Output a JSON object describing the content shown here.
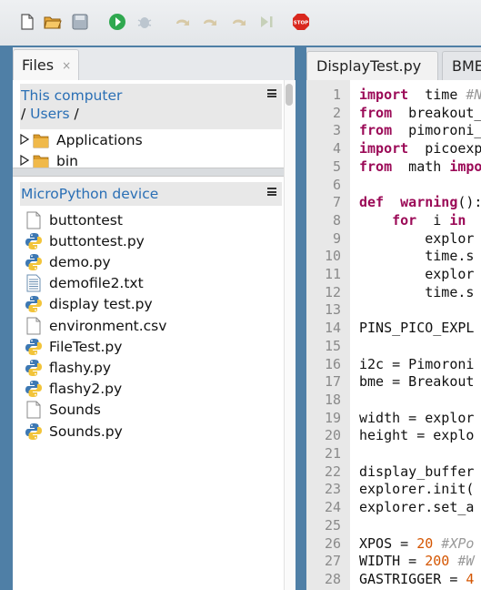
{
  "toolbar": {
    "buttons": [
      "new-file-icon",
      "open-folder-icon",
      "save-icon",
      "run-icon",
      "debug-icon",
      "step-over-icon",
      "step-into-icon",
      "step-out-icon",
      "resume-icon",
      "stop-icon"
    ],
    "stop_label": "STOP"
  },
  "files_panel": {
    "tab_label": "Files",
    "tab_close": "×",
    "computer": {
      "title": "This computer",
      "path": [
        "/",
        "Users",
        "/"
      ],
      "items": [
        {
          "label": "Applications",
          "type": "folder"
        },
        {
          "label": "bin",
          "type": "folder"
        }
      ]
    },
    "device": {
      "title": "MicroPython device",
      "items": [
        {
          "label": "buttontest",
          "type": "file"
        },
        {
          "label": "buttontest.py",
          "type": "python"
        },
        {
          "label": "demo.py",
          "type": "python"
        },
        {
          "label": "demofile2.txt",
          "type": "text"
        },
        {
          "label": "display test.py",
          "type": "python"
        },
        {
          "label": "environment.csv",
          "type": "file"
        },
        {
          "label": "FileTest.py",
          "type": "python"
        },
        {
          "label": "flashy.py",
          "type": "python"
        },
        {
          "label": "flashy2.py",
          "type": "python"
        },
        {
          "label": "Sounds",
          "type": "file"
        },
        {
          "label": "Sounds.py",
          "type": "python"
        }
      ]
    }
  },
  "editor": {
    "tabs": [
      "DisplayTest.py",
      "BME"
    ],
    "lines": [
      {
        "n": "1",
        "segs": [
          [
            "kw",
            "import"
          ],
          [
            "",
            "  time "
          ],
          [
            "cm",
            "#N"
          ]
        ]
      },
      {
        "n": "2",
        "segs": [
          [
            "kw",
            "from"
          ],
          [
            "",
            "  breakout_"
          ]
        ]
      },
      {
        "n": "3",
        "segs": [
          [
            "kw",
            "from"
          ],
          [
            "",
            "  pimoroni_"
          ]
        ]
      },
      {
        "n": "4",
        "segs": [
          [
            "kw",
            "import"
          ],
          [
            "",
            "  picoexp"
          ]
        ]
      },
      {
        "n": "5",
        "segs": [
          [
            "kw",
            "from"
          ],
          [
            "",
            "  math "
          ],
          [
            "kw",
            "impo"
          ]
        ]
      },
      {
        "n": "6",
        "segs": []
      },
      {
        "n": "7",
        "segs": [
          [
            "kw",
            "def"
          ],
          [
            "",
            "  "
          ],
          [
            "kw",
            "warning"
          ],
          [
            "",
            "():"
          ]
        ]
      },
      {
        "n": "8",
        "segs": [
          [
            "",
            "    "
          ],
          [
            "kw",
            "for"
          ],
          [
            "",
            "  i "
          ],
          [
            "kw",
            "in"
          ],
          [
            "",
            "  r"
          ]
        ]
      },
      {
        "n": "9",
        "segs": [
          [
            "",
            "        explor"
          ]
        ]
      },
      {
        "n": "10",
        "segs": [
          [
            "",
            "        time.s"
          ]
        ]
      },
      {
        "n": "11",
        "segs": [
          [
            "",
            "        explor"
          ]
        ]
      },
      {
        "n": "12",
        "segs": [
          [
            "",
            "        time.s"
          ]
        ]
      },
      {
        "n": "13",
        "segs": []
      },
      {
        "n": "14",
        "segs": [
          [
            "",
            "PINS_PICO_EXPL"
          ]
        ]
      },
      {
        "n": "15",
        "segs": []
      },
      {
        "n": "16",
        "segs": [
          [
            "",
            "i2c = Pimoroni"
          ]
        ]
      },
      {
        "n": "17",
        "segs": [
          [
            "",
            "bme = Breakout"
          ]
        ]
      },
      {
        "n": "18",
        "segs": []
      },
      {
        "n": "19",
        "segs": [
          [
            "",
            "width = explor"
          ]
        ]
      },
      {
        "n": "20",
        "segs": [
          [
            "",
            "height = explo"
          ]
        ]
      },
      {
        "n": "21",
        "segs": []
      },
      {
        "n": "22",
        "segs": [
          [
            "",
            "display_buffer"
          ]
        ]
      },
      {
        "n": "23",
        "segs": [
          [
            "",
            "explorer.init("
          ]
        ]
      },
      {
        "n": "24",
        "segs": [
          [
            "",
            "explorer.set_a"
          ]
        ]
      },
      {
        "n": "25",
        "segs": []
      },
      {
        "n": "26",
        "segs": [
          [
            "",
            "XPOS = "
          ],
          [
            "num",
            "20"
          ],
          [
            "cm",
            " #XPo"
          ]
        ]
      },
      {
        "n": "27",
        "segs": [
          [
            "",
            "WIDTH = "
          ],
          [
            "num",
            "200"
          ],
          [
            "cm",
            " #W"
          ]
        ]
      },
      {
        "n": "28",
        "segs": [
          [
            "",
            "GASTRIGGER = "
          ],
          [
            "num",
            "4"
          ]
        ]
      }
    ]
  }
}
